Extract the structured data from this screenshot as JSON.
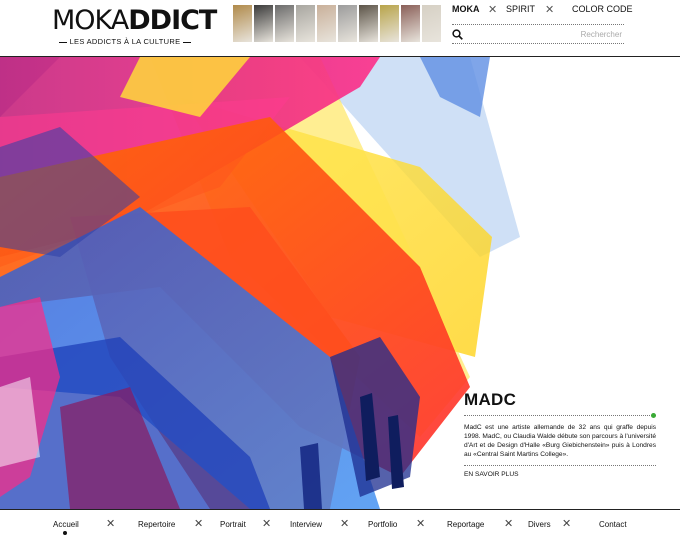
{
  "header": {
    "logo": {
      "word_light": "MOKA",
      "word_bold": "DDICT",
      "tagline": "LES ADDICTS À LA CULTURE"
    },
    "thumbnails": [
      {
        "name": "thumb-painting",
        "color": "#b08a4a"
      },
      {
        "name": "thumb-dark-portrait",
        "color": "#3a3a3a"
      },
      {
        "name": "thumb-black-white",
        "color": "#6b6b6b"
      },
      {
        "name": "thumb-figures",
        "color": "#a8a6a0"
      },
      {
        "name": "thumb-portrait",
        "color": "#c9b09a"
      },
      {
        "name": "thumb-gray",
        "color": "#9c9c9c"
      },
      {
        "name": "thumb-person",
        "color": "#5c5448"
      },
      {
        "name": "thumb-art",
        "color": "#b8a44a"
      },
      {
        "name": "thumb-poster",
        "color": "#8a5f58"
      },
      {
        "name": "thumb-figure",
        "color": "#d6d0c4"
      }
    ],
    "nav": {
      "items": [
        "MOKA",
        "SPIRIT",
        "COLOR CODE"
      ]
    },
    "search": {
      "placeholder": "Rechercher"
    }
  },
  "feature": {
    "title": "MADC",
    "description": "MadC est une artiste allemande de 32 ans qui graffe depuis 1998. MadC, ou Claudia Walde débute son parcours à l'université d'Art et de Design d'Halle «Burg Giebichenstein» puis à Londres au «Central Saint Martins College».",
    "link": "EN SAVOIR PLUS",
    "accent": "#3aaa35"
  },
  "pager": {
    "count": 3,
    "active": 0
  },
  "bottom_nav": {
    "items": [
      "Accueil",
      "Repertoire",
      "Portrait",
      "Interview",
      "Portfolio",
      "Reportage",
      "Divers",
      "Contact"
    ],
    "active": "Accueil"
  }
}
